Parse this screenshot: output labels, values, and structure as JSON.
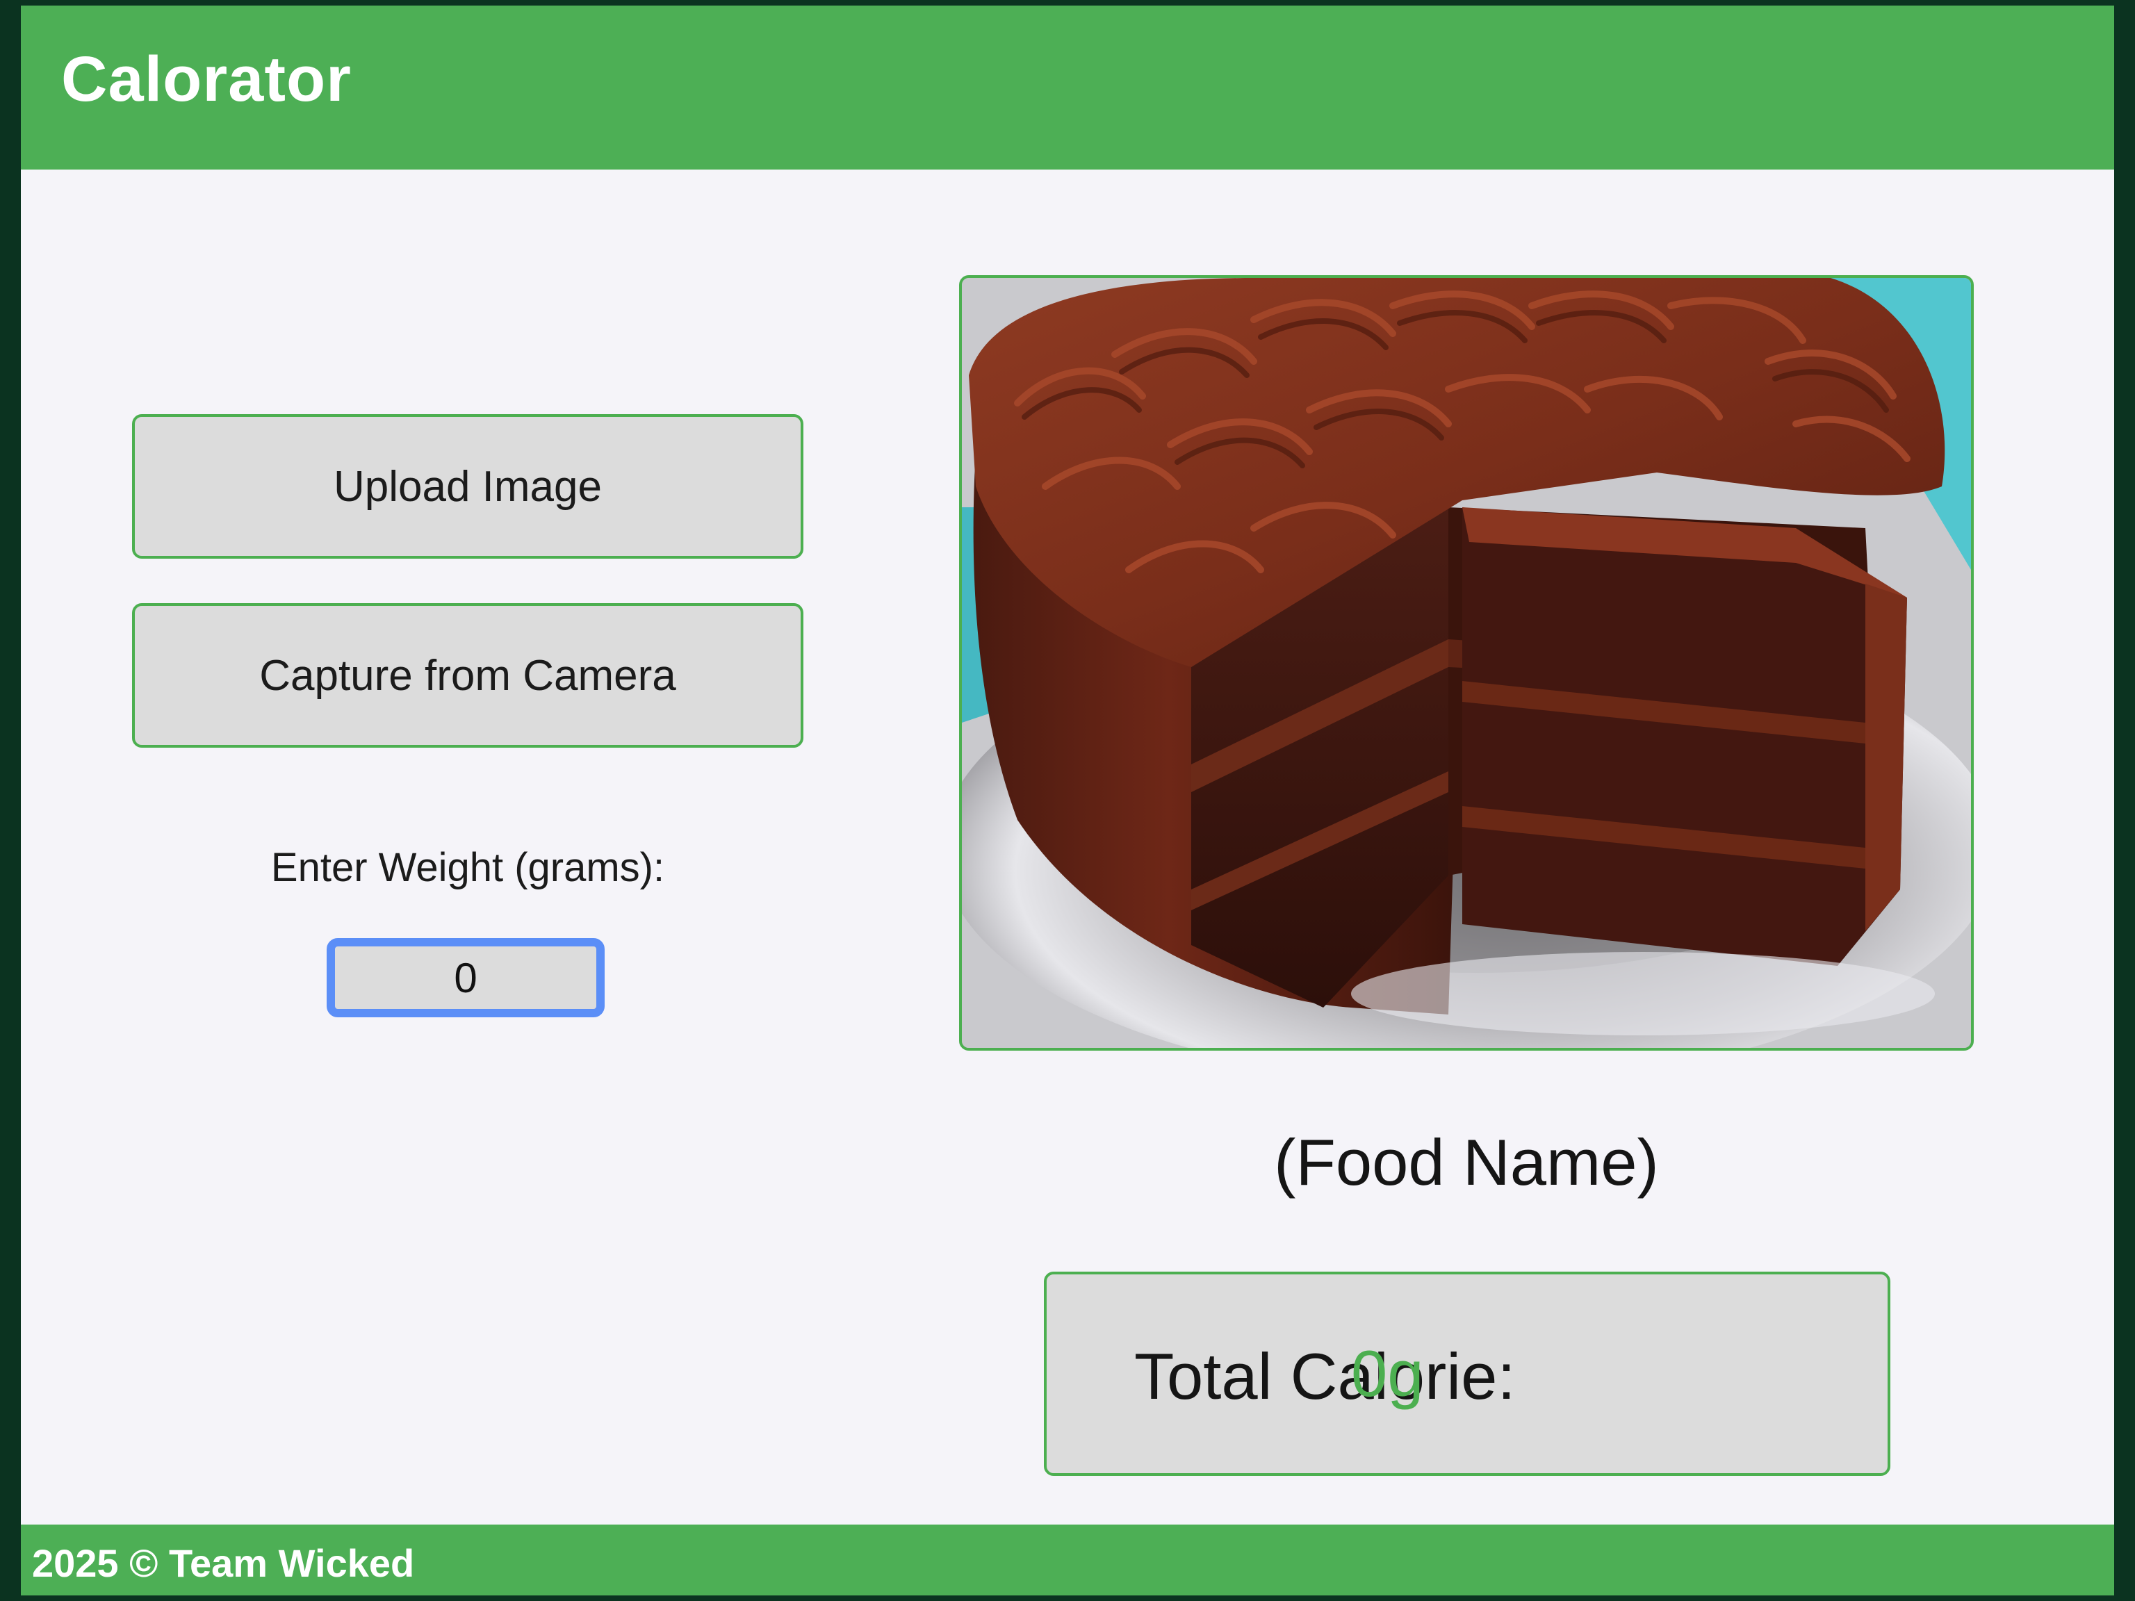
{
  "header": {
    "title": "Calorator"
  },
  "actions": {
    "upload_label": "Upload Image",
    "camera_label": "Capture from Camera"
  },
  "weight": {
    "label": "Enter Weight (grams):",
    "value": "0"
  },
  "result": {
    "food_name": "(Food Name)",
    "calorie_label": "Total Calorie:",
    "calorie_value": "0g"
  },
  "footer": {
    "text": "2025 © Team Wicked"
  },
  "colors": {
    "primary": "#4daf55",
    "accent_green": "#4caf50",
    "page_bg": "#f5f4f9",
    "outer_bg": "#0b3320",
    "focus_ring": "#5b8ef7",
    "button_bg": "#dcdcdc"
  },
  "image": {
    "subject": "chocolate-layer-cake-photo"
  }
}
